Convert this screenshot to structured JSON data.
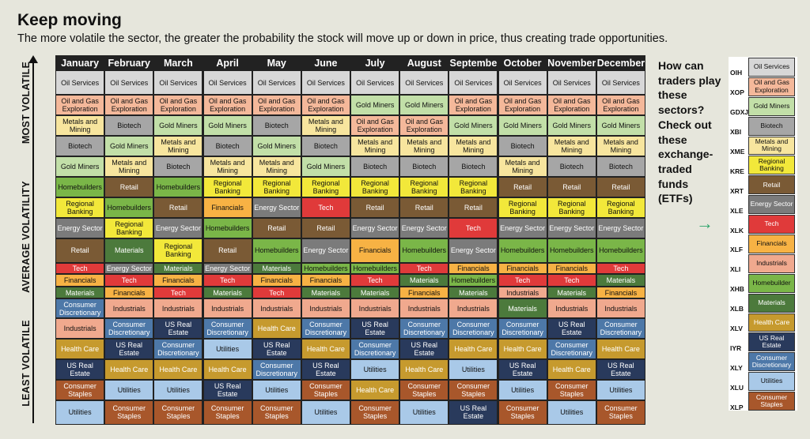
{
  "title": "Keep moving",
  "subtitle": "The more volatile the sector, the greater the probability the stock will move up or down in price, thus creating trade opportunities.",
  "y_labels": [
    "MOST VOLATILE",
    "AVERAGE VOLATILITY",
    "LEAST VOLATILE"
  ],
  "promo_text": "How can traders play these sectors? Check out these exchange-traded funds (ETFs)",
  "colors": {
    "Oil Services": "#d7d7d7",
    "Oil and Gas Exploration": "#f4b89a",
    "Metals and Mining": "#f7e59e",
    "Biotech": "#a6a6a6",
    "Gold Miners": "#c2dfa8",
    "Homebuilders": "#7ab648",
    "Retail": "#7a5a35",
    "Regional Banking": "#f2e83a",
    "Energy Sector": "#7b7b7b",
    "Tech": "#e03a3a",
    "Financials": "#f7b244",
    "Materials": "#4c7a3c",
    "Consumer Discretionary": "#4d78a8",
    "Industrials": "#f0a98e",
    "US Real Estate": "#293a5c",
    "Health Care": "#c69a2e",
    "Utilities": "#a9c9e8",
    "Consumer Staples": "#a8572b"
  },
  "text_light": [
    "Retail",
    "Energy Sector",
    "Tech",
    "Materials",
    "Consumer Discretionary",
    "US Real Estate",
    "Health Care",
    "Consumer Staples"
  ],
  "chart_data": {
    "type": "table",
    "title": "Keep moving",
    "subtitle": "The more volatile the sector, the greater the probability the stock will move up or down in price, thus creating trade opportunities.",
    "months": [
      "January",
      "February",
      "March",
      "April",
      "May",
      "June",
      "July",
      "August",
      "Septembe",
      "October",
      "November",
      "December"
    ],
    "rankings": [
      [
        "Oil Services",
        "Oil and Gas Exploration",
        "Metals and Mining",
        "Biotech",
        "Gold Miners",
        "Homebuilders",
        "Regional Banking",
        "Energy Sector",
        "Retail",
        "Tech",
        "Financials",
        "Materials",
        "Consumer Discretionary",
        "Industrials",
        "Health Care",
        "US Real Estate",
        "Consumer Staples",
        "Utilities"
      ],
      [
        "Oil Services",
        "Oil and Gas Exploration",
        "Biotech",
        "Gold Miners",
        "Metals and Mining",
        "Retail",
        "Homebuilders",
        "Regional Banking",
        "Materials",
        "Energy Sector",
        "Tech",
        "Financials",
        "Industrials",
        "Consumer Discretionary",
        "US Real Estate",
        "Health Care",
        "Utilities",
        "Consumer Staples"
      ],
      [
        "Oil Services",
        "Oil and Gas Exploration",
        "Gold Miners",
        "Metals and Mining",
        "Biotech",
        "Homebuilders",
        "Retail",
        "Energy Sector",
        "Regional Banking",
        "Materials",
        "Financials",
        "Tech",
        "Industrials",
        "US Real Estate",
        "Consumer Discretionary",
        "Health Care",
        "Utilities",
        "Consumer Staples"
      ],
      [
        "Oil Services",
        "Oil and Gas Exploration",
        "Gold Miners",
        "Biotech",
        "Metals and Mining",
        "Regional Banking",
        "Financials",
        "Homebuilders",
        "Retail",
        "Energy Sector",
        "Tech",
        "Materials",
        "Industrials",
        "Consumer Discretionary",
        "Utilities",
        "Health Care",
        "US Real Estate",
        "Consumer Staples"
      ],
      [
        "Oil Services",
        "Oil and Gas Exploration",
        "Biotech",
        "Gold Miners",
        "Metals and Mining",
        "Regional Banking",
        "Energy Sector",
        "Retail",
        "Homebuilders",
        "Materials",
        "Financials",
        "Tech",
        "Industrials",
        "Health Care",
        "US Real Estate",
        "Consumer Discretionary",
        "Utilities",
        "Consumer Staples"
      ],
      [
        "Oil Services",
        "Oil and Gas Exploration",
        "Metals and Mining",
        "Biotech",
        "Gold Miners",
        "Regional Banking",
        "Tech",
        "Retail",
        "Energy Sector",
        "Homebuilders",
        "Financials",
        "Materials",
        "Industrials",
        "Consumer Discretionary",
        "Health Care",
        "US Real Estate",
        "Consumer Staples",
        "Utilities"
      ],
      [
        "Oil Services",
        "Gold Miners",
        "Oil and Gas Exploration",
        "Metals and Mining",
        "Biotech",
        "Regional Banking",
        "Retail",
        "Energy Sector",
        "Financials",
        "Homebuilders",
        "Tech",
        "Materials",
        "Industrials",
        "US Real Estate",
        "Consumer Discretionary",
        "Utilities",
        "Health Care",
        "Consumer Staples"
      ],
      [
        "Oil Services",
        "Gold Miners",
        "Oil and Gas Exploration",
        "Metals and Mining",
        "Biotech",
        "Regional Banking",
        "Retail",
        "Energy Sector",
        "Homebuilders",
        "Tech",
        "Materials",
        "Financials",
        "Industrials",
        "Consumer Discretionary",
        "US Real Estate",
        "Health Care",
        "Consumer Staples",
        "Utilities"
      ],
      [
        "Oil Services",
        "Oil and Gas Exploration",
        "Gold Miners",
        "Metals and Mining",
        "Biotech",
        "Regional Banking",
        "Retail",
        "Tech",
        "Energy Sector",
        "Financials",
        "Homebuilders",
        "Materials",
        "Industrials",
        "Consumer Discretionary",
        "Health Care",
        "Utilities",
        "Consumer Staples",
        "US Real Estate"
      ],
      [
        "Oil Services",
        "Oil and Gas Exploration",
        "Gold Miners",
        "Biotech",
        "Metals and Mining",
        "Retail",
        "Regional Banking",
        "Energy Sector",
        "Homebuilders",
        "Financials",
        "Tech",
        "Industrials",
        "Materials",
        "Consumer Discretionary",
        "Health Care",
        "US Real Estate",
        "Utilities",
        "Consumer Staples"
      ],
      [
        "Oil Services",
        "Oil and Gas Exploration",
        "Gold Miners",
        "Metals and Mining",
        "Biotech",
        "Retail",
        "Regional Banking",
        "Energy Sector",
        "Homebuilders",
        "Financials",
        "Tech",
        "Materials",
        "Industrials",
        "US Real Estate",
        "Consumer Discretionary",
        "Health Care",
        "Consumer Staples",
        "Utilities"
      ],
      [
        "Oil Services",
        "Oil and Gas Exploration",
        "Gold Miners",
        "Metals and Mining",
        "Biotech",
        "Retail",
        "Regional Banking",
        "Energy Sector",
        "Homebuilders",
        "Tech",
        "Materials",
        "Financials",
        "Industrials",
        "Consumer Discretionary",
        "Health Care",
        "US Real Estate",
        "Utilities",
        "Consumer Staples"
      ]
    ]
  },
  "etfs": [
    {
      "ticker": "OIH",
      "sector": "Oil Services"
    },
    {
      "ticker": "XOP",
      "sector": "Oil and Gas Exploration"
    },
    {
      "ticker": "GDXJ",
      "sector": "Gold Miners"
    },
    {
      "ticker": "XBI",
      "sector": "Biotech"
    },
    {
      "ticker": "XME",
      "sector": "Metals and Mining"
    },
    {
      "ticker": "KRE",
      "sector": "Regional Banking"
    },
    {
      "ticker": "XRT",
      "sector": "Retail"
    },
    {
      "ticker": "XLE",
      "sector": "Energy Sector"
    },
    {
      "ticker": "XLK",
      "sector": "Tech"
    },
    {
      "ticker": "XLF",
      "sector": "Financials"
    },
    {
      "ticker": "XLI",
      "sector": "Industrials"
    },
    {
      "ticker": "XHB",
      "sector": "Homebuilder"
    },
    {
      "ticker": "XLB",
      "sector": "Materials"
    },
    {
      "ticker": "XLV",
      "sector": "Health Care"
    },
    {
      "ticker": "IYR",
      "sector": "US Real Estate"
    },
    {
      "ticker": "XLY",
      "sector": "Consumer Discretionary"
    },
    {
      "ticker": "XLU",
      "sector": "Utilities"
    },
    {
      "ticker": "XLP",
      "sector": "Consumer Staples"
    }
  ]
}
